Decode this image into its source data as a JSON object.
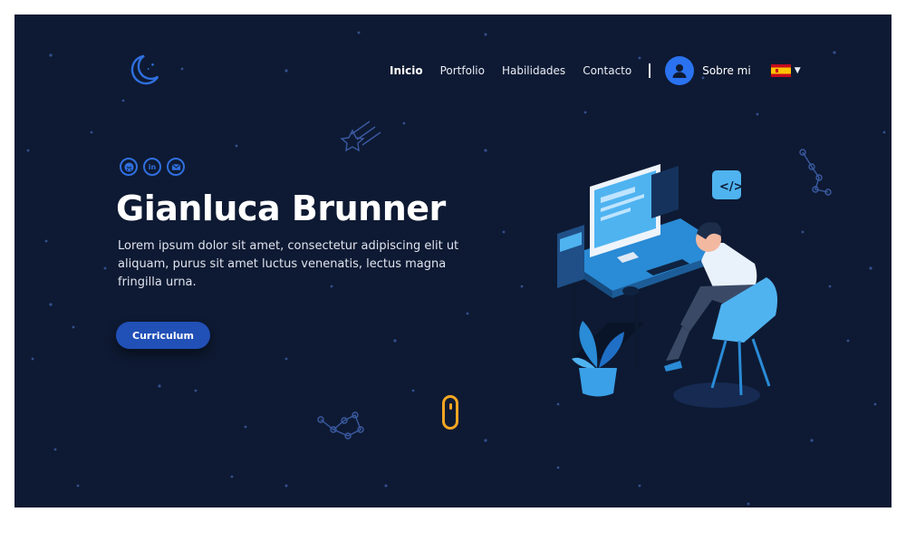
{
  "nav": {
    "items": [
      "Inicio",
      "Portfolio",
      "Habilidades",
      "Contacto"
    ],
    "active": "Inicio",
    "about_label": "Sobre mi",
    "language": "Español"
  },
  "hero": {
    "title": "Gianluca Brunner",
    "description": "Lorem ipsum dolor sit amet, consectetur adipiscing elit ut aliquam, purus sit amet luctus venenatis, lectus magna fringilla urna.",
    "cta_label": "Curriculum"
  },
  "socials": {
    "github_icon": "github-icon",
    "linkedin_label": "in",
    "mail_icon": "mail-icon"
  },
  "colors": {
    "background": "#0e1a33",
    "accent": "#2150b7",
    "icon_blue": "#2f6fde",
    "scroll_indicator": "#f5a623"
  }
}
